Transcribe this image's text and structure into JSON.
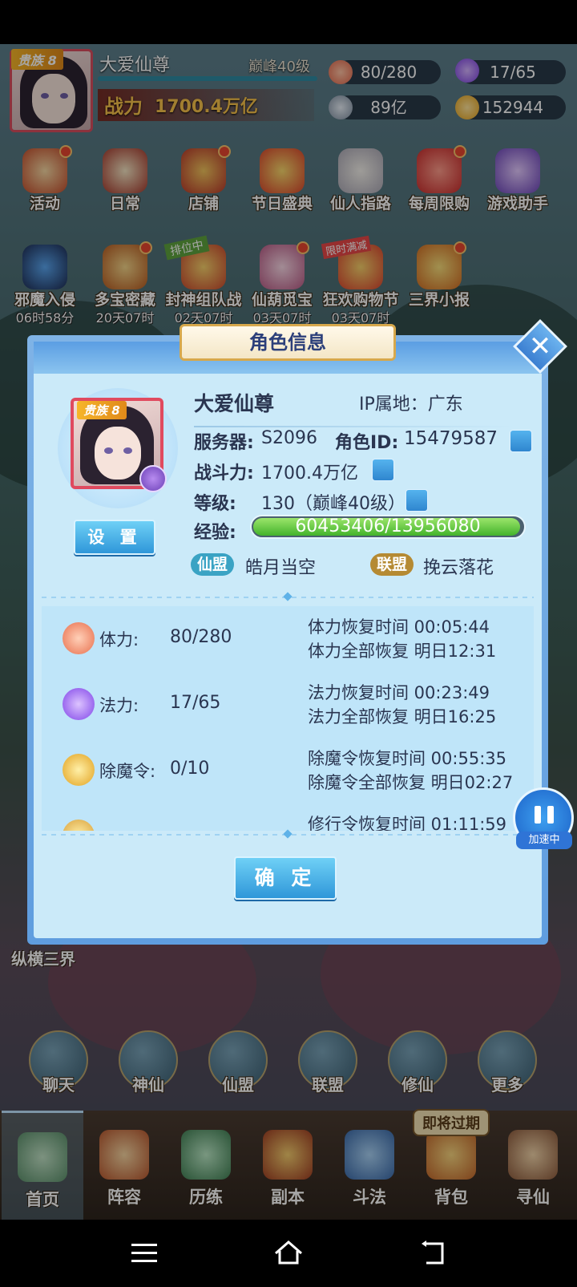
{
  "header": {
    "player_name": "大爱仙尊",
    "rank_tag": "贵族 8",
    "level_text": "巅峰40级",
    "power_label": "战力",
    "power_value": "1700.4万亿"
  },
  "resources": [
    {
      "icon": "peach-icon",
      "value": "80/280",
      "color": "#f28a64"
    },
    {
      "icon": "purple-flame-icon",
      "value": "17/65",
      "color": "#9b5cf0"
    },
    {
      "icon": "coin-silver-icon",
      "value": "89亿",
      "color": "#9aa9b8"
    },
    {
      "icon": "gold-ingot-icon",
      "value": "152944",
      "color": "#f2b62c"
    }
  ],
  "activity_row1": [
    {
      "label": "活动",
      "icon": "drum-icon"
    },
    {
      "label": "日常",
      "icon": "scroll-icon"
    },
    {
      "label": "店铺",
      "icon": "shop-icon"
    },
    {
      "label": "节日盛典",
      "icon": "gift-box-icon"
    },
    {
      "label": "仙人指路",
      "icon": "immortal-icon"
    },
    {
      "label": "每周限购",
      "icon": "red-bag-icon"
    },
    {
      "label": "游戏助手",
      "icon": "helper-girl-icon"
    }
  ],
  "activity_row2": [
    {
      "label": "邪魔入侵",
      "timer": "06时58分",
      "icon": "demon-icon"
    },
    {
      "label": "多宝密藏",
      "timer": "20天07时",
      "icon": "treasure-icon"
    },
    {
      "label": "封神组队战",
      "timer": "02天07时",
      "icon": "team-battle-icon",
      "tag": "排位中"
    },
    {
      "label": "仙葫觅宝",
      "timer": "03天07时",
      "icon": "gourd-icon"
    },
    {
      "label": "狂欢购物节",
      "timer": "03天07时",
      "icon": "shopping-icon",
      "tag": "限时满减"
    },
    {
      "label": "三界小报",
      "timer": "",
      "icon": "newspaper-icon"
    }
  ],
  "side_labels": {
    "left_bottom": "纵横三界"
  },
  "round_icons": [
    {
      "label": "聊天",
      "icon": "chat-icon"
    },
    {
      "label": "神仙",
      "icon": "deity-icon"
    },
    {
      "label": "仙盟",
      "icon": "guild-book-icon"
    },
    {
      "label": "联盟",
      "icon": "alliance-banner-icon"
    },
    {
      "label": "修仙",
      "icon": "crane-icon"
    },
    {
      "label": "更多",
      "icon": "more-flower-icon"
    }
  ],
  "expire_tag": "即将过期",
  "bottom_nav": [
    {
      "label": "首页",
      "icon": "home-island-icon",
      "selected": true
    },
    {
      "label": "阵容",
      "icon": "cards-icon"
    },
    {
      "label": "历练",
      "icon": "training-icon"
    },
    {
      "label": "副本",
      "icon": "dungeon-gate-icon"
    },
    {
      "label": "斗法",
      "icon": "battle-icon"
    },
    {
      "label": "背包",
      "icon": "bag-icon"
    },
    {
      "label": "寻仙",
      "icon": "seek-immortal-icon"
    }
  ],
  "dialog": {
    "title": "角色信息",
    "name": "大爱仙尊",
    "ip_location": "IP属地：广东",
    "rank_tag": "贵族 8",
    "server_label": "服务器:",
    "server_value": "S2096",
    "role_id_label": "角色ID:",
    "role_id_value": "15479587",
    "power_label": "战斗力:",
    "power_value": "1700.4万亿",
    "level_label": "等级:",
    "level_value": "130（巅峰40级）",
    "exp_label": "经验:",
    "exp_text": "60453406/13956080",
    "exp_fill_fraction": 0.98,
    "settings_label": "设 置",
    "guild_tag": "仙盟",
    "guild_name": "皓月当空",
    "alliance_tag": "联盟",
    "alliance_name": "挽云落花",
    "confirm_label": "确 定",
    "stats": [
      {
        "name": "体力:",
        "value": "80/280",
        "line1": "体力恢复时间 00:05:44",
        "line2": "体力全部恢复 明日12:31",
        "icon": "peach-icon",
        "color": "#f28a64"
      },
      {
        "name": "法力:",
        "value": "17/65",
        "line1": "法力恢复时间 00:23:49",
        "line2": "法力全部恢复 明日16:25",
        "icon": "purple-flame-icon",
        "color": "#9b5cf0"
      },
      {
        "name": "除魔令:",
        "value": "0/10",
        "line1": "除魔令恢复时间 00:55:35",
        "line2": "除魔令全部恢复 明日02:27",
        "icon": "token-icon",
        "color": "#f2c12c"
      },
      {
        "name": "",
        "value": "",
        "line1": "修行令恢复时间 01:11:59",
        "line2": "",
        "icon": "cultivation-token-icon",
        "color": "#e7b43a"
      }
    ]
  },
  "speed_badge": "加速中"
}
